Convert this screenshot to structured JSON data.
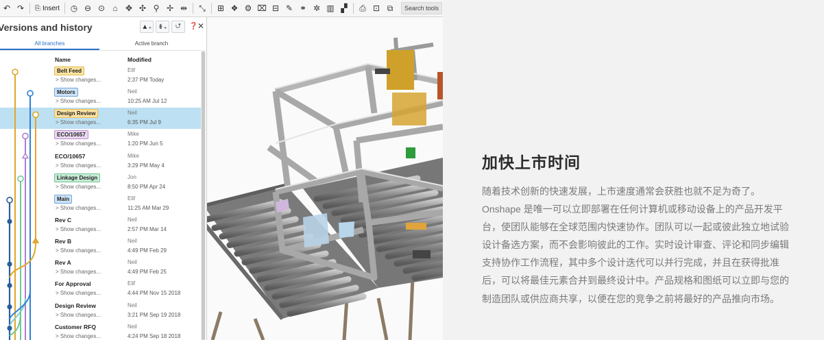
{
  "toolbar": {
    "insert_label": "Insert",
    "search_label": "Search tools",
    "icons": [
      "undo",
      "redo",
      "insert",
      "history",
      "shell",
      "fillet",
      "chamfer",
      "pattern",
      "transform",
      "assembly",
      "mate",
      "mirror",
      "trim",
      "measure",
      "section",
      "render",
      "sketch",
      "table",
      "drawing",
      "orbit",
      "settings",
      "align",
      "section-view",
      "export",
      "fullscreen"
    ]
  },
  "panel": {
    "title": "Versions and history",
    "tabs": [
      "All branches",
      "Active branch"
    ],
    "columns": {
      "name": "Name",
      "modified": "Modified"
    },
    "rows": [
      {
        "name": "Belt Feed",
        "tag": "yellow",
        "changes": "> Show changes...",
        "user": "Elif",
        "date": "2:37 PM Today"
      },
      {
        "name": "Motors",
        "tag": "blue",
        "changes": "> Show changes...",
        "user": "Neil",
        "date": "10:25 AM Jul 12"
      },
      {
        "name": "Design Review",
        "tag": "yellow",
        "changes": "> Show changes...",
        "user": "Neil",
        "date": "6:35 PM Jul 9",
        "selected": true
      },
      {
        "name": "ECO/10657",
        "tag": "purple",
        "changes": "> Show changes...",
        "user": "Mike",
        "date": "1:20 PM Jun 5"
      },
      {
        "name": "ECO/10657",
        "tag": "",
        "changes": "> Show changes...",
        "user": "Mike",
        "date": "3:29 PM May 4"
      },
      {
        "name": "Linkage Design",
        "tag": "green",
        "changes": "> Show changes...",
        "user": "Jon",
        "date": "8:50 PM Apr 24"
      },
      {
        "name": "Main",
        "tag": "blue",
        "changes": "> Show changes...",
        "user": "Elif",
        "date": "11:25 AM Mar 29"
      },
      {
        "name": "Rev C",
        "tag": "",
        "changes": "> Show changes...",
        "user": "Neil",
        "date": "2:57 PM Mar 14"
      },
      {
        "name": "Rev B",
        "tag": "",
        "changes": "> Show changes...",
        "user": "Neil",
        "date": "4:49 PM Feb 29"
      },
      {
        "name": "Rev A",
        "tag": "",
        "changes": "> Show changes...",
        "user": "Neil",
        "date": "4:49 PM Feb 25"
      },
      {
        "name": "For Approval",
        "tag": "",
        "changes": "> Show changes...",
        "user": "Elif",
        "date": "4:44 PM Nov 15 2018"
      },
      {
        "name": "Design Review",
        "tag": "",
        "changes": "> Show changes...",
        "user": "Neil",
        "date": "3:21 PM Sep 19 2018"
      },
      {
        "name": "Customer RFQ",
        "tag": "",
        "changes": "> Show changes...",
        "user": "Neil",
        "date": "4:24 PM Sep 18 2018"
      }
    ]
  },
  "tag_colors": {
    "yellow": {
      "bg": "#fbe3a2",
      "border": "#e5b94f"
    },
    "blue": {
      "bg": "#cfe4f7",
      "border": "#6fa6dc"
    },
    "purple": {
      "bg": "#ead9f1",
      "border": "#b98ccc"
    },
    "green": {
      "bg": "#c8ebd6",
      "border": "#6fc493"
    }
  },
  "graph_colors": {
    "yellow": "#e0a62a",
    "blue": "#2f7fd6",
    "purple": "#b07cc9",
    "green": "#6ccb94",
    "teal": "#7fcfcf",
    "navy": "#2a5d9a"
  },
  "right": {
    "headline": "加快上市时间",
    "body": [
      "随着技术创新的快速发展，上市速度通常会获胜也就不足为奇了。",
      "Onshape 是唯一可以立即部署在任何计算机或移动设备上的产品开发平台，使团队能够在全球范围内快速协作。团队可以一起或彼此独立地试验设计备选方案，而不会影响彼此的工作。实时设计审查、评论和同步编辑支持协作工作流程，其中多个设计迭代可以并行完成，并且在获得批准后，可以将最佳元素合并到最终设计中。产品规格和图纸可以立即与您的制造团队或供应商共享，以便在您的竞争之前将最好的产品推向市场。"
    ]
  }
}
